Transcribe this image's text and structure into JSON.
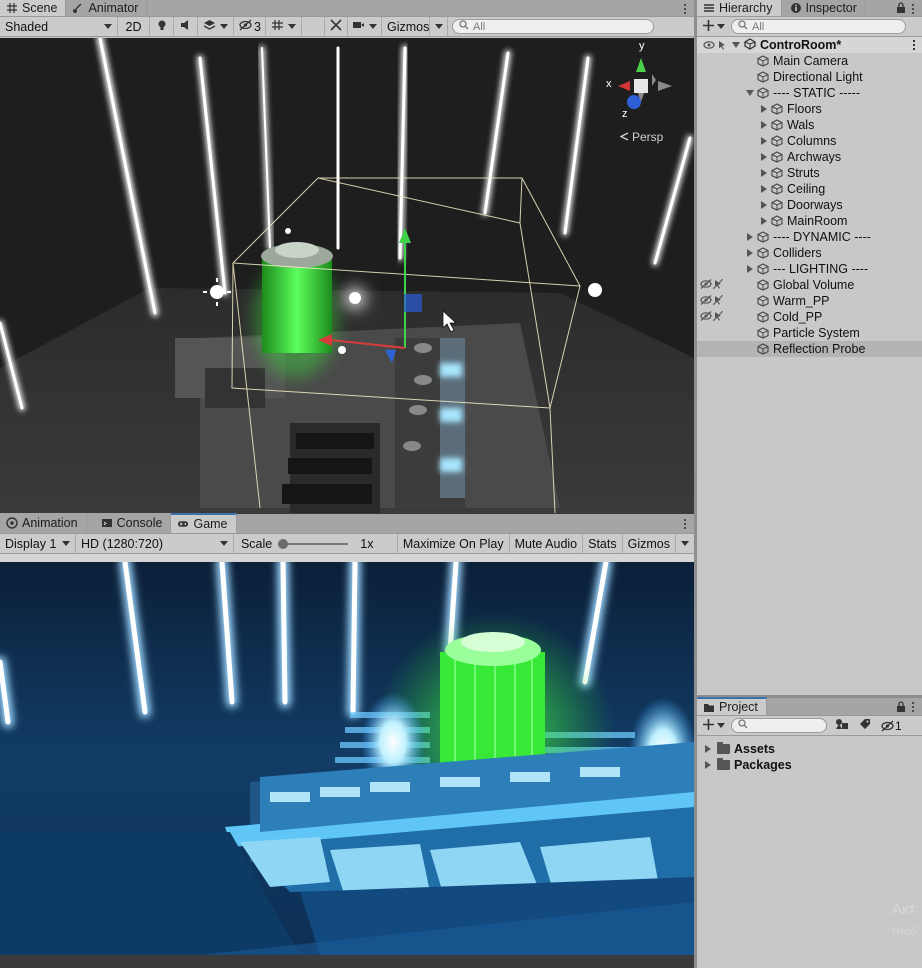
{
  "scene": {
    "tabs": [
      {
        "label": "Scene",
        "icon": "grid-icon"
      },
      {
        "label": "Animator",
        "icon": "animator-icon"
      }
    ],
    "toolbar": {
      "shading_mode": "Shaded",
      "mode_2d": "2D",
      "hidden_count": "3",
      "gizmos_label": "Gizmos",
      "search_placeholder": "All"
    },
    "gizmo": {
      "axis_y": "y",
      "axis_x": "x",
      "axis_z": "z",
      "projection": "Persp"
    }
  },
  "game": {
    "tabs": [
      {
        "label": "Animation",
        "icon": "animation-icon"
      },
      {
        "label": "Console",
        "icon": "console-icon"
      },
      {
        "label": "Game",
        "icon": "gamepad-icon"
      }
    ],
    "toolbar": {
      "display": "Display 1",
      "resolution": "HD (1280:720)",
      "scale_label": "Scale",
      "scale_value": "1x",
      "maximize": "Maximize On Play",
      "mute": "Mute Audio",
      "stats": "Stats",
      "gizmos": "Gizmos"
    }
  },
  "hierarchy": {
    "tabs": [
      {
        "label": "Hierarchy",
        "icon": "list-icon"
      },
      {
        "label": "Inspector",
        "icon": "info-icon"
      }
    ],
    "search_placeholder": "All",
    "scene_name": "ControRoom*",
    "items": [
      {
        "label": "Main Camera",
        "depth": 1,
        "fold": "none",
        "hidden": false
      },
      {
        "label": "Directional Light",
        "depth": 1,
        "fold": "none",
        "hidden": false
      },
      {
        "label": "---- STATIC -----",
        "depth": 1,
        "fold": "open",
        "hidden": false
      },
      {
        "label": "Floors",
        "depth": 2,
        "fold": "closed",
        "hidden": false
      },
      {
        "label": "Wals",
        "depth": 2,
        "fold": "closed",
        "hidden": false
      },
      {
        "label": "Columns",
        "depth": 2,
        "fold": "closed",
        "hidden": false
      },
      {
        "label": "Archways",
        "depth": 2,
        "fold": "closed",
        "hidden": false
      },
      {
        "label": "Struts",
        "depth": 2,
        "fold": "closed",
        "hidden": false
      },
      {
        "label": "Ceiling",
        "depth": 2,
        "fold": "closed",
        "hidden": false
      },
      {
        "label": "Doorways",
        "depth": 2,
        "fold": "closed",
        "hidden": false
      },
      {
        "label": "MainRoom",
        "depth": 2,
        "fold": "closed",
        "hidden": false
      },
      {
        "label": "---- DYNAMIC ----",
        "depth": 1,
        "fold": "closed",
        "hidden": false
      },
      {
        "label": "Colliders",
        "depth": 1,
        "fold": "closed",
        "hidden": false
      },
      {
        "label": "--- LIGHTING ----",
        "depth": 1,
        "fold": "closed",
        "hidden": false
      },
      {
        "label": "Global Volume",
        "depth": 1,
        "fold": "none",
        "hidden": true
      },
      {
        "label": "Warm_PP",
        "depth": 1,
        "fold": "none",
        "hidden": true
      },
      {
        "label": "Cold_PP",
        "depth": 1,
        "fold": "none",
        "hidden": true
      },
      {
        "label": "Particle System",
        "depth": 1,
        "fold": "none",
        "hidden": false
      },
      {
        "label": "Reflection Probe",
        "depth": 1,
        "fold": "none",
        "hidden": false,
        "selected": true
      }
    ]
  },
  "project": {
    "tab_label": "Project",
    "hidden_count": "1",
    "folders": [
      {
        "label": "Assets"
      },
      {
        "label": "Packages"
      }
    ],
    "watermark_line1": "Акт",
    "watermark_line2": "Чтоб"
  },
  "colors": {
    "editor_bg": "#c2c2c2",
    "active_tab_accent": "#3a72b0",
    "scene_bg": "#222222",
    "game_bg": "#0a2a4a",
    "glow_green": "#39e23a",
    "glow_cyan": "#7fd8ff"
  }
}
